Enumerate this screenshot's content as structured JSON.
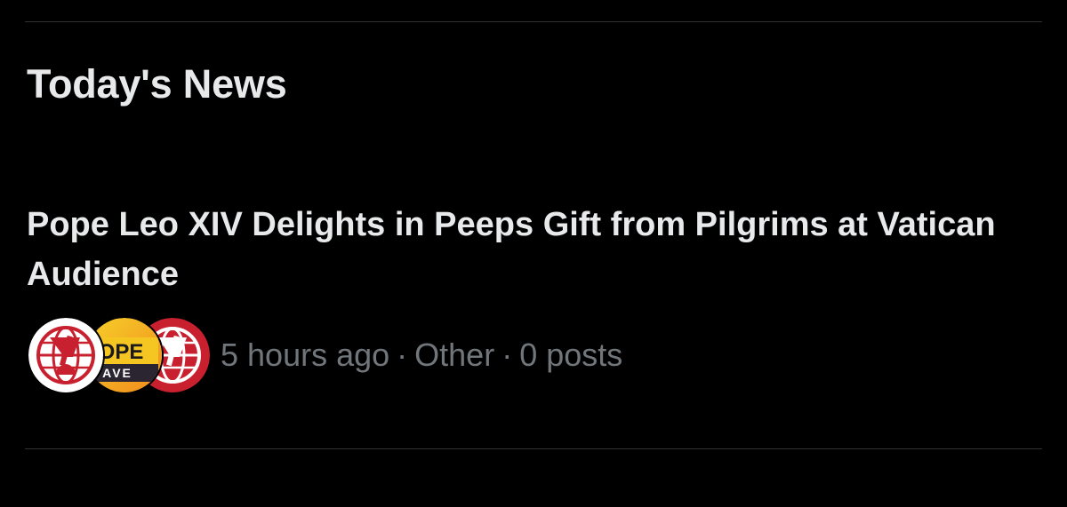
{
  "section": {
    "title": "Today's News"
  },
  "news_item": {
    "headline": "Pope Leo XIV Delights in Peeps Gift from Pilgrims at Vatican Audience",
    "time_ago": "5 hours ago",
    "separator": "·",
    "category": "Other",
    "post_count": "0 posts",
    "avatars": [
      {
        "icon": "cross-globe-logo-white-icon"
      },
      {
        "icon": "pope-wave-logo-icon",
        "text_top": "OPE",
        "text_bottom": "AVE"
      },
      {
        "icon": "cross-globe-logo-red-icon"
      }
    ]
  },
  "colors": {
    "background": "#000000",
    "primary_text": "#e7e9ea",
    "secondary_text": "#71767b",
    "divider": "#2f3336",
    "logo_red": "#c8202f",
    "logo_orange": "#f4a01c"
  }
}
